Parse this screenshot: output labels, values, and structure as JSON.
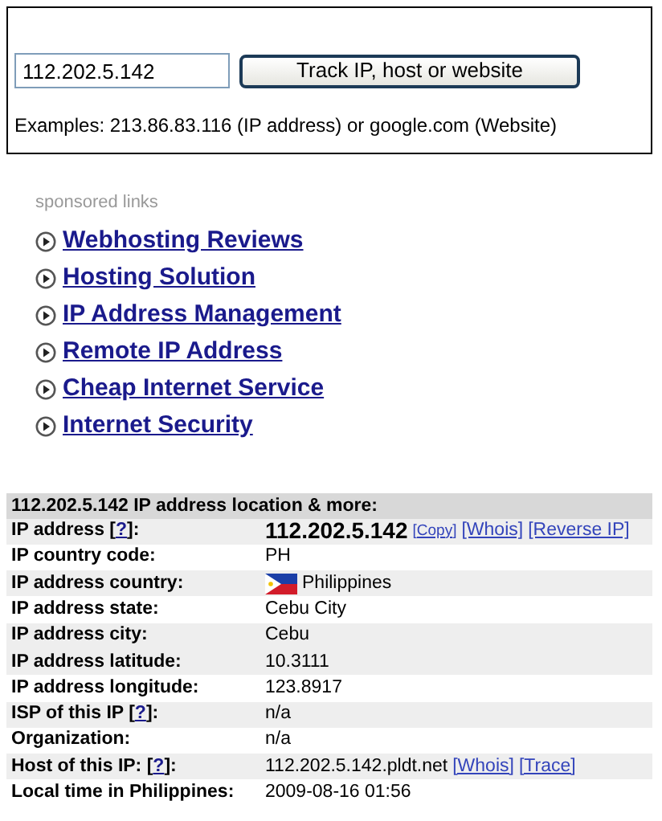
{
  "search": {
    "value": "112.202.5.142",
    "button": "Track IP, host or website",
    "examples": "Examples: 213.86.83.116 (IP address) or google.com (Website)"
  },
  "sponsored": {
    "heading": "sponsored links",
    "links": [
      "Webhosting Reviews",
      "Hosting Solution",
      "IP Address Management",
      "Remote IP Address",
      "Cheap Internet Service",
      "Internet Security"
    ]
  },
  "table": {
    "title": "112.202.5.142 IP address location & more:",
    "rows": [
      {
        "label": "IP address [",
        "help": "?",
        "label_end": "]:",
        "shaded": true,
        "value": [
          {
            "kind": "strong",
            "text": "112.202.5.142"
          },
          {
            "kind": "small-link",
            "text": "[Copy]"
          },
          {
            "kind": "link",
            "text": "[Whois]"
          },
          {
            "kind": "link",
            "text": "[Reverse IP]"
          }
        ]
      },
      {
        "label": "IP country code:",
        "shaded": false,
        "value": [
          {
            "kind": "text",
            "text": "PH"
          }
        ]
      },
      {
        "label": "IP address country:",
        "shaded": true,
        "value": [
          {
            "kind": "flag"
          },
          {
            "kind": "text",
            "text": "Philippines"
          }
        ]
      },
      {
        "label": "IP address state:",
        "shaded": false,
        "value": [
          {
            "kind": "text",
            "text": "Cebu City"
          }
        ]
      },
      {
        "label": "IP address city:",
        "shaded": true,
        "value": [
          {
            "kind": "text",
            "text": "Cebu"
          }
        ]
      },
      {
        "label": "IP address latitude:",
        "shaded": true,
        "value": [
          {
            "kind": "text",
            "text": "10.3111"
          }
        ]
      },
      {
        "label": "IP address longitude:",
        "shaded": false,
        "value": [
          {
            "kind": "text",
            "text": "123.8917"
          }
        ]
      },
      {
        "label": "ISP of this IP [",
        "help": "?",
        "label_end": "]:",
        "shaded": true,
        "value": [
          {
            "kind": "text",
            "text": "n/a"
          }
        ]
      },
      {
        "label": "Organization:",
        "shaded": false,
        "value": [
          {
            "kind": "text",
            "text": "n/a"
          }
        ]
      },
      {
        "label": "Host of this IP: [",
        "help": "?",
        "label_end": "]:",
        "shaded": true,
        "value": [
          {
            "kind": "text",
            "text": "112.202.5.142.pldt.net"
          },
          {
            "kind": "link",
            "text": "[Whois]"
          },
          {
            "kind": "link",
            "text": "[Trace]"
          }
        ]
      },
      {
        "label": "Local time in Philippines:",
        "shaded": false,
        "value": [
          {
            "kind": "text",
            "text": "2009-08-16 01:56"
          }
        ]
      }
    ]
  }
}
